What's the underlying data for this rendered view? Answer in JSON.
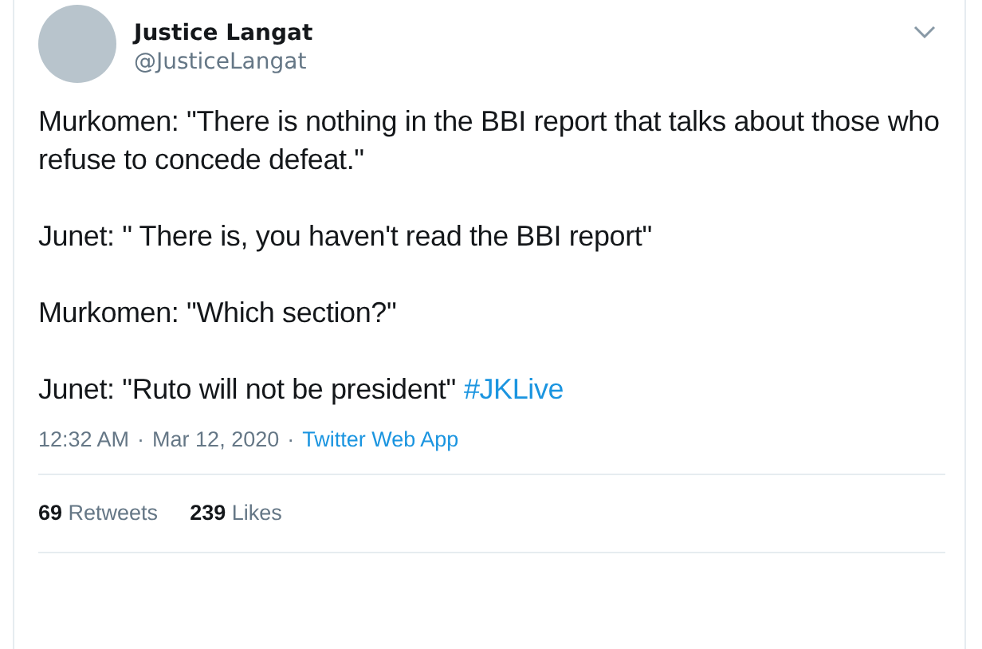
{
  "author": {
    "name": "Justice Langat",
    "handle": "@JusticeLangat"
  },
  "paragraphs": [
    {
      "text": "Murkomen: \"There is nothing in the BBI report that talks about those who refuse to concede defeat.\""
    },
    {
      "text": "Junet: \" There is, you haven't read the BBI report\""
    },
    {
      "text": "Murkomen: \"Which section?\""
    },
    {
      "text": "Junet: \"Ruto will not be president\"",
      "hashtag": "#JKLive"
    }
  ],
  "meta": {
    "time": "12:32 AM",
    "separator": "·",
    "date": "Mar 12, 2020",
    "separator2": "·",
    "source": "Twitter Web App"
  },
  "stats": [
    {
      "text": "**69** Retweets"
    },
    {
      "text": "**239** Likes"
    }
  ]
}
